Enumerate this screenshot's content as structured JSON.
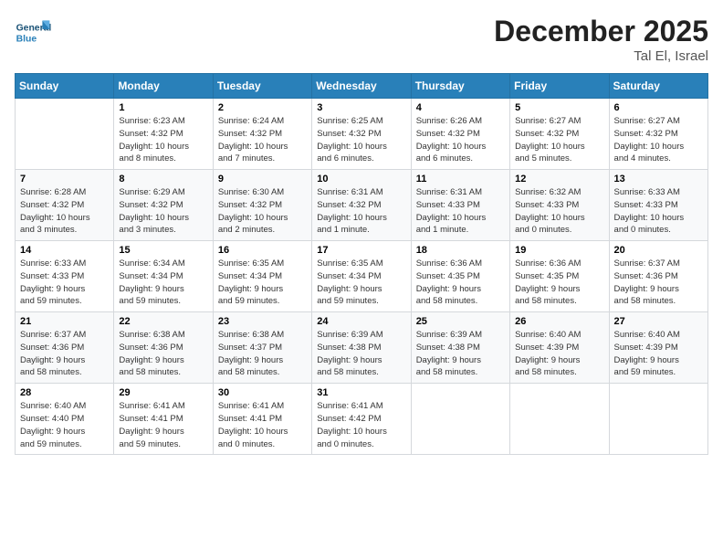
{
  "logo": {
    "general": "General",
    "blue": "Blue"
  },
  "title": "December 2025",
  "location": "Tal El, Israel",
  "days_of_week": [
    "Sunday",
    "Monday",
    "Tuesday",
    "Wednesday",
    "Thursday",
    "Friday",
    "Saturday"
  ],
  "weeks": [
    [
      {
        "day": "",
        "info": ""
      },
      {
        "day": "1",
        "info": "Sunrise: 6:23 AM\nSunset: 4:32 PM\nDaylight: 10 hours\nand 8 minutes."
      },
      {
        "day": "2",
        "info": "Sunrise: 6:24 AM\nSunset: 4:32 PM\nDaylight: 10 hours\nand 7 minutes."
      },
      {
        "day": "3",
        "info": "Sunrise: 6:25 AM\nSunset: 4:32 PM\nDaylight: 10 hours\nand 6 minutes."
      },
      {
        "day": "4",
        "info": "Sunrise: 6:26 AM\nSunset: 4:32 PM\nDaylight: 10 hours\nand 6 minutes."
      },
      {
        "day": "5",
        "info": "Sunrise: 6:27 AM\nSunset: 4:32 PM\nDaylight: 10 hours\nand 5 minutes."
      },
      {
        "day": "6",
        "info": "Sunrise: 6:27 AM\nSunset: 4:32 PM\nDaylight: 10 hours\nand 4 minutes."
      }
    ],
    [
      {
        "day": "7",
        "info": "Sunrise: 6:28 AM\nSunset: 4:32 PM\nDaylight: 10 hours\nand 3 minutes."
      },
      {
        "day": "8",
        "info": "Sunrise: 6:29 AM\nSunset: 4:32 PM\nDaylight: 10 hours\nand 3 minutes."
      },
      {
        "day": "9",
        "info": "Sunrise: 6:30 AM\nSunset: 4:32 PM\nDaylight: 10 hours\nand 2 minutes."
      },
      {
        "day": "10",
        "info": "Sunrise: 6:31 AM\nSunset: 4:32 PM\nDaylight: 10 hours\nand 1 minute."
      },
      {
        "day": "11",
        "info": "Sunrise: 6:31 AM\nSunset: 4:33 PM\nDaylight: 10 hours\nand 1 minute."
      },
      {
        "day": "12",
        "info": "Sunrise: 6:32 AM\nSunset: 4:33 PM\nDaylight: 10 hours\nand 0 minutes."
      },
      {
        "day": "13",
        "info": "Sunrise: 6:33 AM\nSunset: 4:33 PM\nDaylight: 10 hours\nand 0 minutes."
      }
    ],
    [
      {
        "day": "14",
        "info": "Sunrise: 6:33 AM\nSunset: 4:33 PM\nDaylight: 9 hours\nand 59 minutes."
      },
      {
        "day": "15",
        "info": "Sunrise: 6:34 AM\nSunset: 4:34 PM\nDaylight: 9 hours\nand 59 minutes."
      },
      {
        "day": "16",
        "info": "Sunrise: 6:35 AM\nSunset: 4:34 PM\nDaylight: 9 hours\nand 59 minutes."
      },
      {
        "day": "17",
        "info": "Sunrise: 6:35 AM\nSunset: 4:34 PM\nDaylight: 9 hours\nand 59 minutes."
      },
      {
        "day": "18",
        "info": "Sunrise: 6:36 AM\nSunset: 4:35 PM\nDaylight: 9 hours\nand 58 minutes."
      },
      {
        "day": "19",
        "info": "Sunrise: 6:36 AM\nSunset: 4:35 PM\nDaylight: 9 hours\nand 58 minutes."
      },
      {
        "day": "20",
        "info": "Sunrise: 6:37 AM\nSunset: 4:36 PM\nDaylight: 9 hours\nand 58 minutes."
      }
    ],
    [
      {
        "day": "21",
        "info": "Sunrise: 6:37 AM\nSunset: 4:36 PM\nDaylight: 9 hours\nand 58 minutes."
      },
      {
        "day": "22",
        "info": "Sunrise: 6:38 AM\nSunset: 4:36 PM\nDaylight: 9 hours\nand 58 minutes."
      },
      {
        "day": "23",
        "info": "Sunrise: 6:38 AM\nSunset: 4:37 PM\nDaylight: 9 hours\nand 58 minutes."
      },
      {
        "day": "24",
        "info": "Sunrise: 6:39 AM\nSunset: 4:38 PM\nDaylight: 9 hours\nand 58 minutes."
      },
      {
        "day": "25",
        "info": "Sunrise: 6:39 AM\nSunset: 4:38 PM\nDaylight: 9 hours\nand 58 minutes."
      },
      {
        "day": "26",
        "info": "Sunrise: 6:40 AM\nSunset: 4:39 PM\nDaylight: 9 hours\nand 58 minutes."
      },
      {
        "day": "27",
        "info": "Sunrise: 6:40 AM\nSunset: 4:39 PM\nDaylight: 9 hours\nand 59 minutes."
      }
    ],
    [
      {
        "day": "28",
        "info": "Sunrise: 6:40 AM\nSunset: 4:40 PM\nDaylight: 9 hours\nand 59 minutes."
      },
      {
        "day": "29",
        "info": "Sunrise: 6:41 AM\nSunset: 4:41 PM\nDaylight: 9 hours\nand 59 minutes."
      },
      {
        "day": "30",
        "info": "Sunrise: 6:41 AM\nSunset: 4:41 PM\nDaylight: 10 hours\nand 0 minutes."
      },
      {
        "day": "31",
        "info": "Sunrise: 6:41 AM\nSunset: 4:42 PM\nDaylight: 10 hours\nand 0 minutes."
      },
      {
        "day": "",
        "info": ""
      },
      {
        "day": "",
        "info": ""
      },
      {
        "day": "",
        "info": ""
      }
    ]
  ]
}
